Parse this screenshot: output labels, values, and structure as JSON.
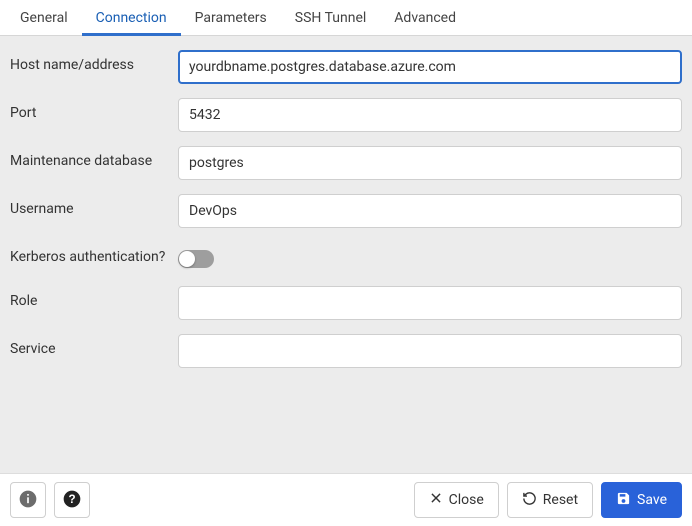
{
  "tabs": {
    "general": "General",
    "connection": "Connection",
    "parameters": "Parameters",
    "sshTunnel": "SSH Tunnel",
    "advanced": "Advanced",
    "active": "connection"
  },
  "form": {
    "host": {
      "label": "Host name/address",
      "value": "yourdbname.postgres.database.azure.com"
    },
    "port": {
      "label": "Port",
      "value": "5432"
    },
    "maintdb": {
      "label": "Maintenance database",
      "value": "postgres"
    },
    "username": {
      "label": "Username",
      "value": "DevOps"
    },
    "kerberos": {
      "label": "Kerberos authentication?",
      "value": false
    },
    "role": {
      "label": "Role",
      "value": ""
    },
    "service": {
      "label": "Service",
      "value": ""
    }
  },
  "footer": {
    "close": "Close",
    "reset": "Reset",
    "save": "Save"
  }
}
